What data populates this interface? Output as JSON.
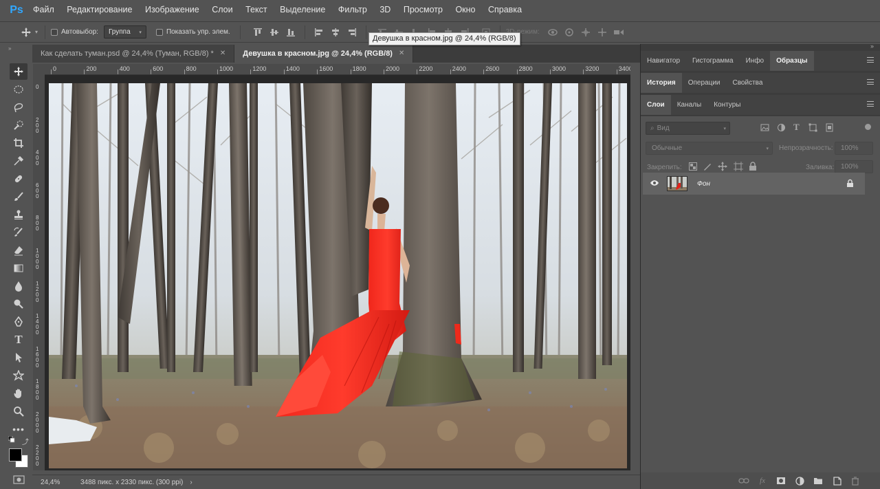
{
  "app": {
    "logo": "Ps"
  },
  "menu": [
    "Файл",
    "Редактирование",
    "Изображение",
    "Слои",
    "Текст",
    "Выделение",
    "Фильтр",
    "3D",
    "Просмотр",
    "Окно",
    "Справка"
  ],
  "options": {
    "autoselect_label": "Автовыбор:",
    "autoselect_value": "Группа",
    "show_controls_label": "Показать упр. элем.",
    "mode_3d_label": "3D-режим:"
  },
  "tooltip": "Девушка в красном.jpg @ 24,4% (RGB/8)",
  "tabs": [
    {
      "label": "Как сделать туман.psd @ 24,4% (Туман, RGB/8) *",
      "active": false
    },
    {
      "label": "Девушка в красном.jpg @ 24,4% (RGB/8)",
      "active": true
    }
  ],
  "ruler_top": [
    "0",
    "200",
    "400",
    "600",
    "800",
    "1000",
    "1200",
    "1400",
    "1600",
    "1800",
    "2000",
    "2200",
    "2400",
    "2600",
    "2800",
    "3000",
    "3200",
    "3400"
  ],
  "ruler_left": [
    "0",
    "2 0 0",
    "4 0 0",
    "6 0 0",
    "8 0 0",
    "1 0 0 0",
    "1 2 0 0",
    "1 4 0 0",
    "1 6 0 0",
    "1 8 0 0",
    "2 0 0 0",
    "2 2 0 0"
  ],
  "status": {
    "zoom": "24,4%",
    "doc_info": "3488 пикс. x 2330 пикс. (300 ppi)"
  },
  "panels": {
    "row1": [
      "Навигатор",
      "Гистограмма",
      "Инфо",
      "Образцы"
    ],
    "row1_active": "Образцы",
    "row2": [
      "История",
      "Операции",
      "Свойства"
    ],
    "row2_active": "История",
    "row3": [
      "Слои",
      "Каналы",
      "Контуры"
    ],
    "row3_active": "Слои"
  },
  "layers": {
    "search_placeholder": "Вид",
    "blend_mode": "Обычные",
    "opacity_label": "Непрозрачность:",
    "opacity_value": "100%",
    "lock_label": "Закрепить:",
    "fill_label": "Заливка:",
    "fill_value": "100%",
    "items": [
      {
        "name": "Фон",
        "visible": true,
        "locked": true
      }
    ]
  }
}
